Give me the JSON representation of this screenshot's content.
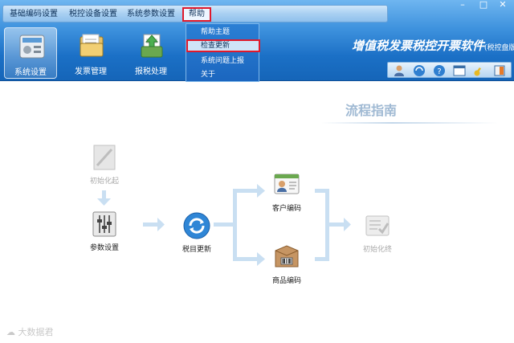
{
  "menubar": {
    "items": [
      "基础编码设置",
      "税控设备设置",
      "系统参数设置"
    ],
    "help": "帮助"
  },
  "window_controls": [
    "–",
    "□",
    "✕"
  ],
  "nav": [
    {
      "label": "系统设置",
      "icon": "settings-icon"
    },
    {
      "label": "发票管理",
      "icon": "folder-icon"
    },
    {
      "label": "报税处理",
      "icon": "tax-report-icon"
    }
  ],
  "help_menu": {
    "items": [
      "帮助主题",
      "检查更新",
      "系统问题上报",
      "关于"
    ],
    "highlighted": "检查更新"
  },
  "app": {
    "title": "增值税发票税控开票软件",
    "subtitle": "(税控盘版)"
  },
  "toolbar_icons": [
    "user-icon",
    "refresh-icon",
    "help-icon",
    "window-icon",
    "key-icon",
    "exit-icon"
  ],
  "flow": {
    "title": "流程指南",
    "nodes": {
      "init_start": "初始化起",
      "params": "参数设置",
      "tax_update": "税目更新",
      "customer": "客户编码",
      "product": "商品编码",
      "init_end": "初始化终"
    }
  },
  "watermark": "大数据君",
  "colors": {
    "header_top": "#6fb6f0",
    "header_bottom": "#1565b8",
    "highlight_border": "#e0192b",
    "flow_arrow": "#c9dff2"
  }
}
